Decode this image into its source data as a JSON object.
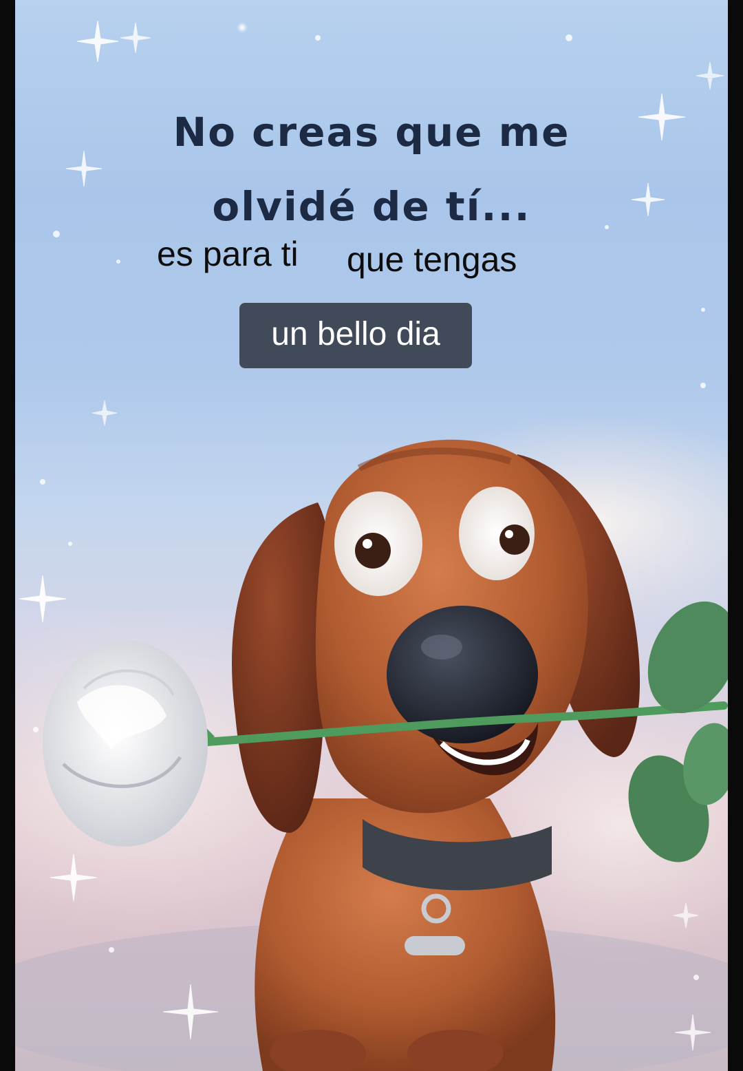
{
  "card": {
    "title_line1": "No creas que me",
    "title_line2": "olvidé de tí...",
    "caption_part1": "es para ti",
    "caption_part2": "que tengas",
    "highlight": "un bello dia"
  },
  "colors": {
    "sky_top": "#b7d1ee",
    "sky_bottom": "#c9bcc6",
    "title_text": "#1d2a44",
    "caption_text": "#0d0d0d",
    "pill_background": "#414a58",
    "pill_text": "#ffffff",
    "dog_fur": "#a8552e",
    "dog_nose": "#1f2430",
    "rose": "#eef0f2",
    "leaf": "#4f8a5c"
  }
}
